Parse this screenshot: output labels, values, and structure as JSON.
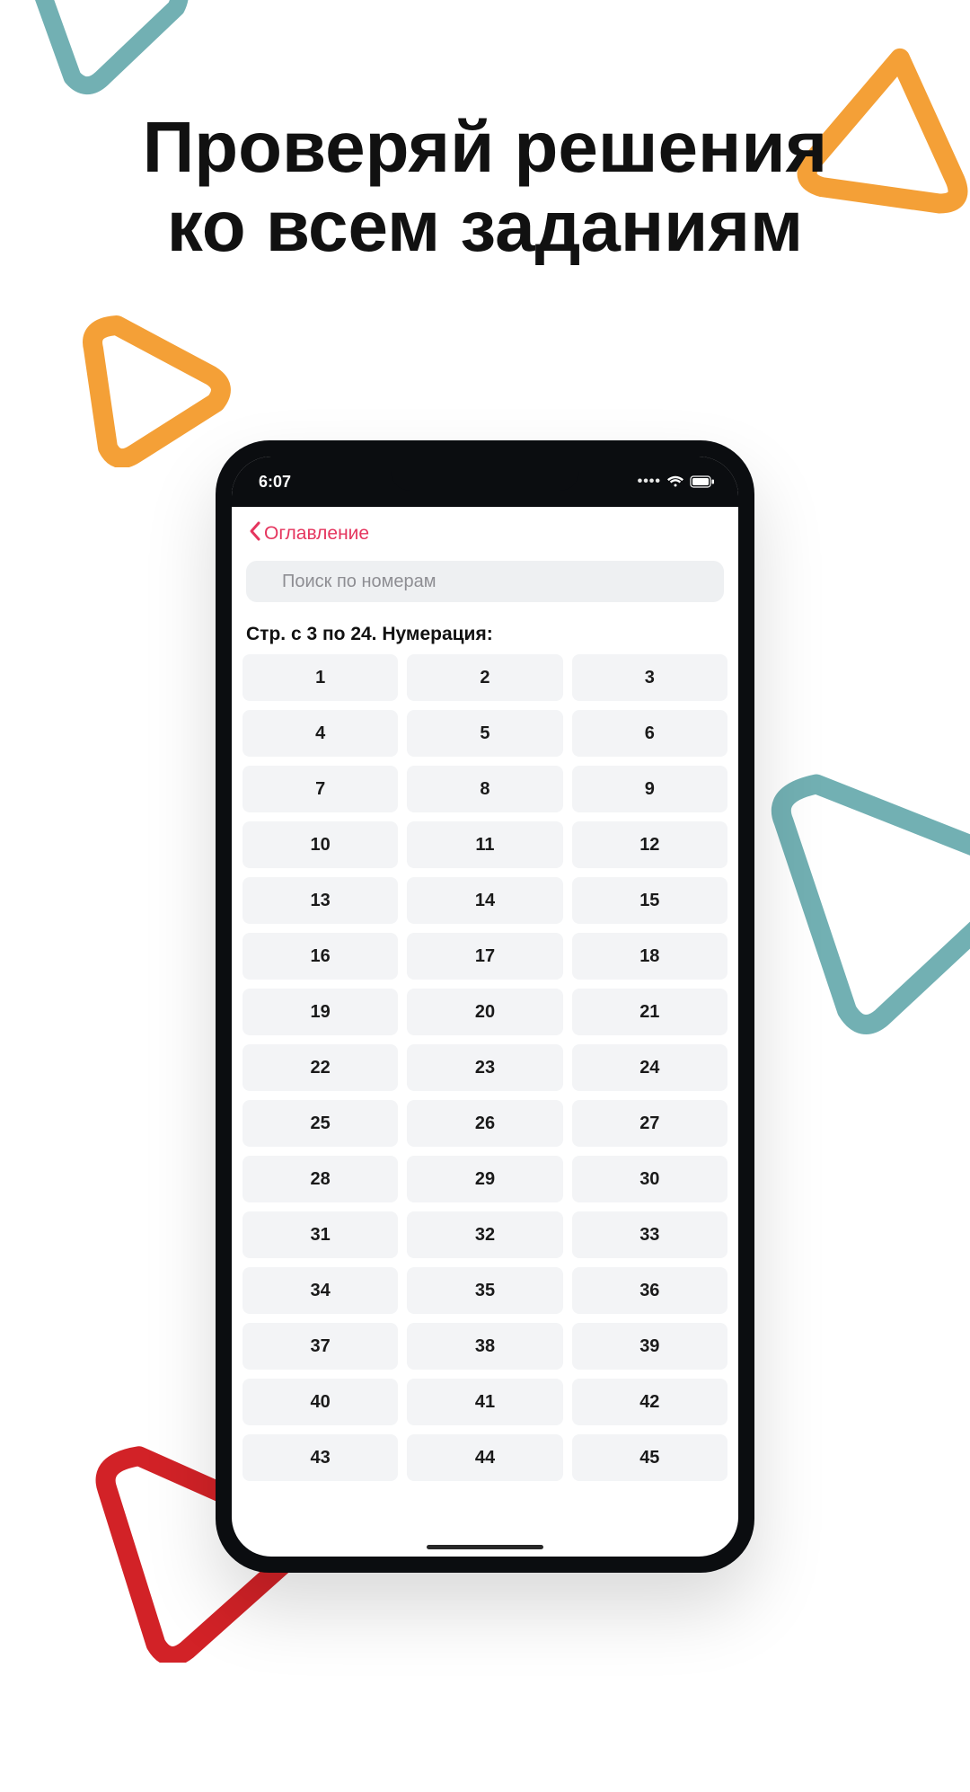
{
  "promo": {
    "headline_line1": "Проверяй решения",
    "headline_line2": "ко всем заданиям"
  },
  "statusbar": {
    "time": "6:07"
  },
  "nav": {
    "back_label": "Оглавление"
  },
  "search": {
    "placeholder": "Поиск по номерам"
  },
  "section": {
    "title": "Стр. с 3 по 24. Нумерация:"
  },
  "numbers": [
    "1",
    "2",
    "3",
    "4",
    "5",
    "6",
    "7",
    "8",
    "9",
    "10",
    "11",
    "12",
    "13",
    "14",
    "15",
    "16",
    "17",
    "18",
    "19",
    "20",
    "21",
    "22",
    "23",
    "24",
    "25",
    "26",
    "27",
    "28",
    "29",
    "30",
    "31",
    "32",
    "33",
    "34",
    "35",
    "36",
    "37",
    "38",
    "39",
    "40",
    "41",
    "42",
    "43",
    "44",
    "45"
  ],
  "shapes": {
    "teal": "#72b0b3",
    "orange": "#f4a037",
    "red": "#d22227"
  }
}
